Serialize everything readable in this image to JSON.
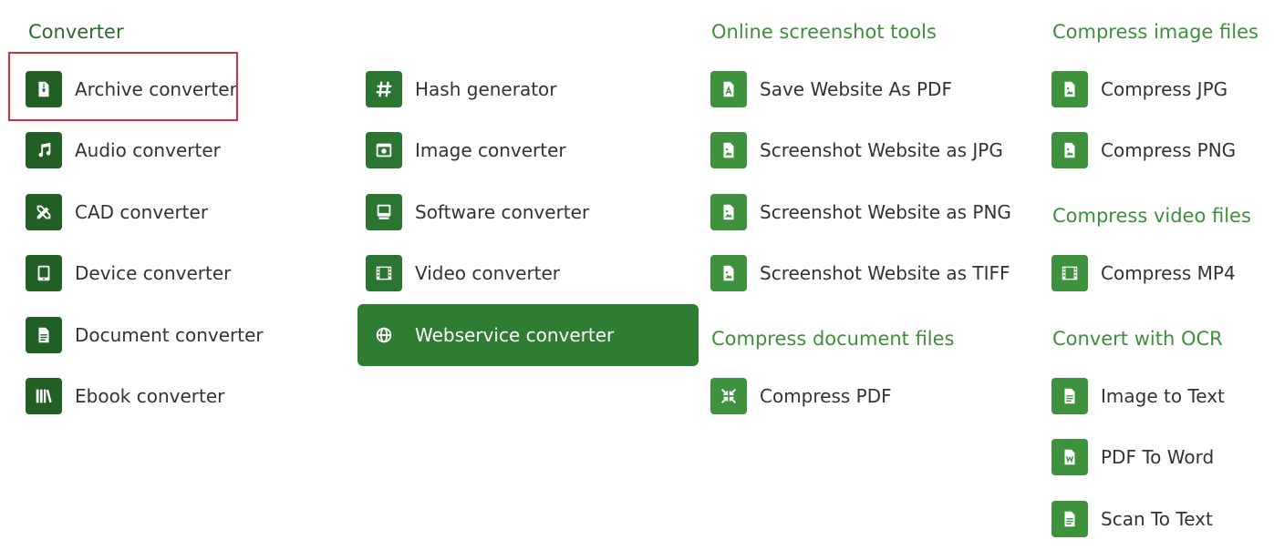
{
  "colors": {
    "heading": "#3f8f3a",
    "icon_dark": "#215f24",
    "icon_medium": "#2a7530",
    "icon_light": "#3e923d",
    "active_bg": "#2e7d32",
    "highlight": "#d13438"
  },
  "converter": {
    "heading": "Converter",
    "items": [
      {
        "label": "Archive converter",
        "icon": "archive-file-icon"
      },
      {
        "label": "Audio converter",
        "icon": "music-note-icon"
      },
      {
        "label": "CAD converter",
        "icon": "ruler-pencil-icon"
      },
      {
        "label": "Device converter",
        "icon": "tablet-icon"
      },
      {
        "label": "Document converter",
        "icon": "document-icon"
      },
      {
        "label": "Ebook converter",
        "icon": "books-icon"
      },
      {
        "label": "Hash generator",
        "icon": "hash-icon"
      },
      {
        "label": "Image converter",
        "icon": "image-icon"
      },
      {
        "label": "Software converter",
        "icon": "monitor-icon"
      },
      {
        "label": "Video converter",
        "icon": "film-icon"
      },
      {
        "label": "Webservice converter",
        "icon": "globe-icon",
        "active": true
      }
    ]
  },
  "screenshot_tools": {
    "heading": "Online screenshot tools",
    "items": [
      {
        "label": "Save Website As PDF",
        "icon": "pdf-file-icon"
      },
      {
        "label": "Screenshot Website as JPG",
        "icon": "image-file-icon"
      },
      {
        "label": "Screenshot Website as PNG",
        "icon": "image-file-icon"
      },
      {
        "label": "Screenshot Website as TIFF",
        "icon": "image-file-icon"
      }
    ]
  },
  "compress_document": {
    "heading": "Compress document files",
    "items": [
      {
        "label": "Compress PDF",
        "icon": "compress-arrows-icon"
      }
    ]
  },
  "compress_image": {
    "heading": "Compress image files",
    "items": [
      {
        "label": "Compress JPG",
        "icon": "image-file-icon"
      },
      {
        "label": "Compress PNG",
        "icon": "image-file-icon"
      }
    ]
  },
  "compress_video": {
    "heading": "Compress video files",
    "items": [
      {
        "label": "Compress MP4",
        "icon": "film-icon"
      }
    ]
  },
  "ocr": {
    "heading": "Convert with OCR",
    "items": [
      {
        "label": "Image to Text",
        "icon": "text-file-icon"
      },
      {
        "label": "PDF To Word",
        "icon": "word-file-icon"
      },
      {
        "label": "Scan To Text",
        "icon": "text-file-icon"
      }
    ]
  }
}
